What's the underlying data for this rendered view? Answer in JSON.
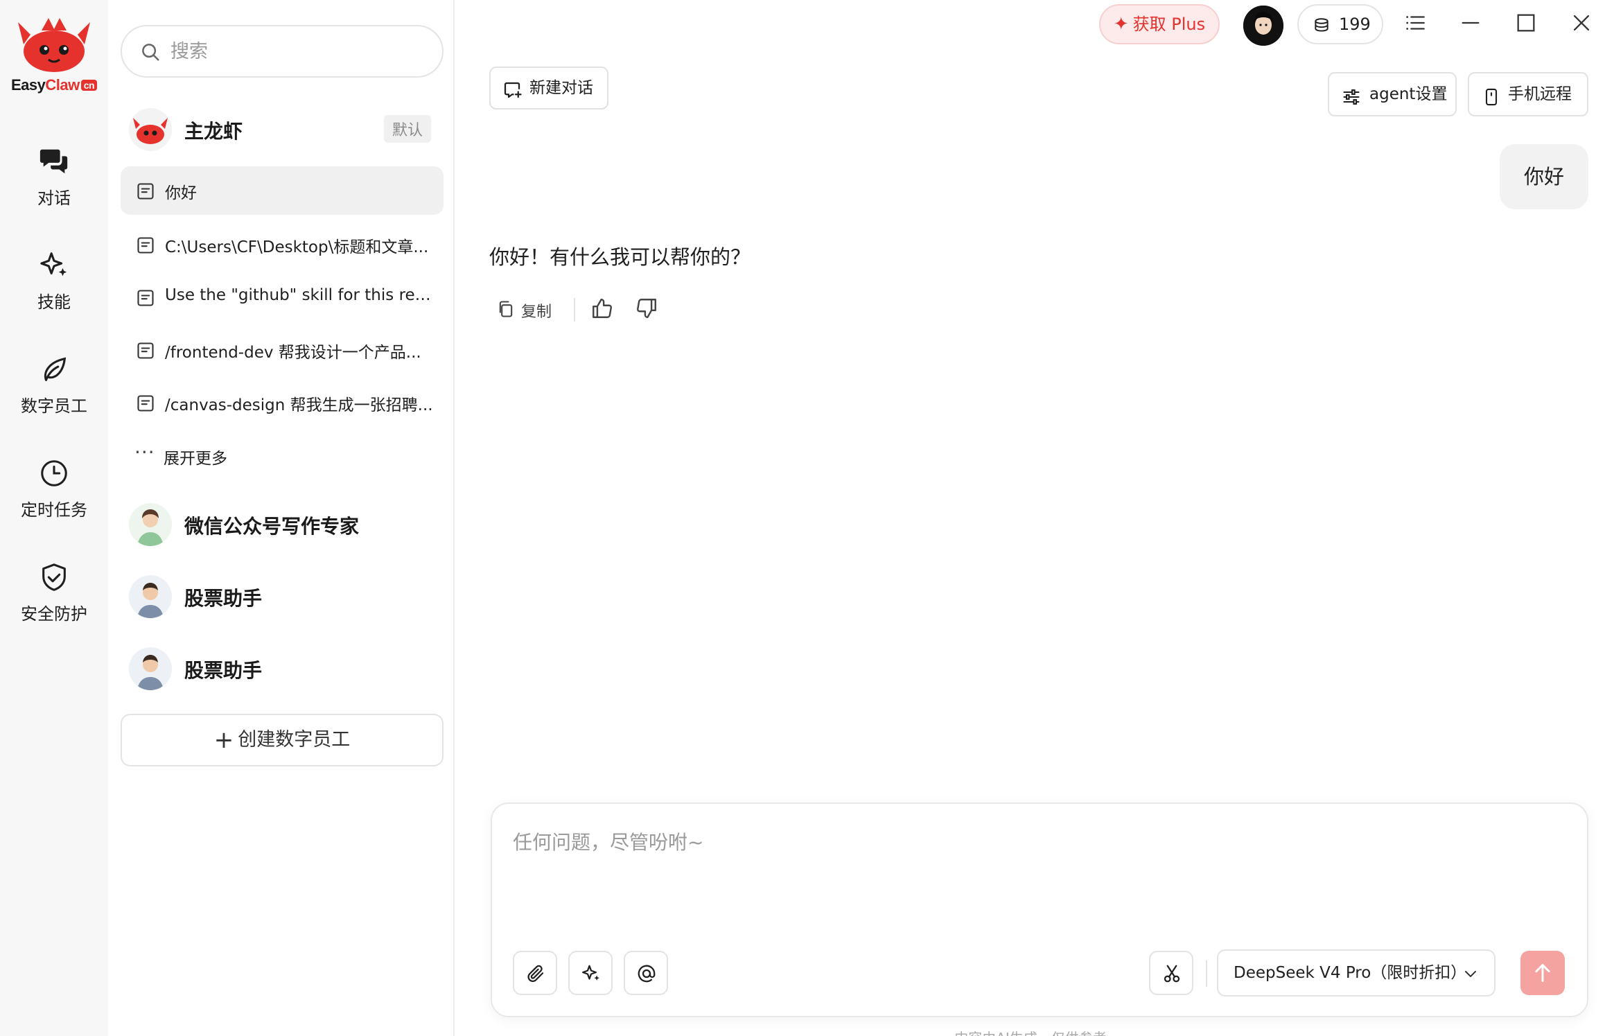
{
  "brand": {
    "logo_easy": "Easy",
    "logo_claw": "Claw",
    "logo_cn": "cn"
  },
  "nav": [
    {
      "label": "对话",
      "icon": "chat-bubbles-icon"
    },
    {
      "label": "技能",
      "icon": "sparkle-star-icon"
    },
    {
      "label": "数字员工",
      "icon": "leaf-icon"
    },
    {
      "label": "定时任务",
      "icon": "clock-icon"
    },
    {
      "label": "安全防护",
      "icon": "shield-check-icon"
    }
  ],
  "search": {
    "placeholder": "搜索"
  },
  "agents": [
    {
      "name": "主龙虾",
      "badge": "默认"
    },
    {
      "name": "微信公众号写作专家"
    },
    {
      "name": "股票助手"
    },
    {
      "name": "股票助手"
    }
  ],
  "conversations": [
    {
      "title": "你好"
    },
    {
      "title": "C:\\Users\\CF\\Desktop\\标题和文章..."
    },
    {
      "title": "Use the \"github\" skill for this requ..."
    },
    {
      "title": "/frontend-dev 帮我设计一个产品..."
    },
    {
      "title": "/canvas-design 帮我生成一张招聘..."
    }
  ],
  "expand_more": "展开更多",
  "create_employee": "创建数字员工",
  "topbar": {
    "plus_label": "获取 Plus",
    "credits": "199"
  },
  "toolbar": {
    "new_chat": "新建对话",
    "agent_settings": "agent设置",
    "phone_remote": "手机远程"
  },
  "messages": {
    "user": "你好",
    "assistant": "你好！有什么我可以帮你的？",
    "copy": "复制"
  },
  "composer": {
    "placeholder": "任何问题，尽管吩咐~",
    "model": "DeepSeek V4 Pro（限时折扣）"
  },
  "footer": "内容由AI生成，仅供参考",
  "colors": {
    "brand_red": "#e5322d",
    "send_button": "#f4a3a1",
    "active_bg": "#f0f0f0"
  }
}
